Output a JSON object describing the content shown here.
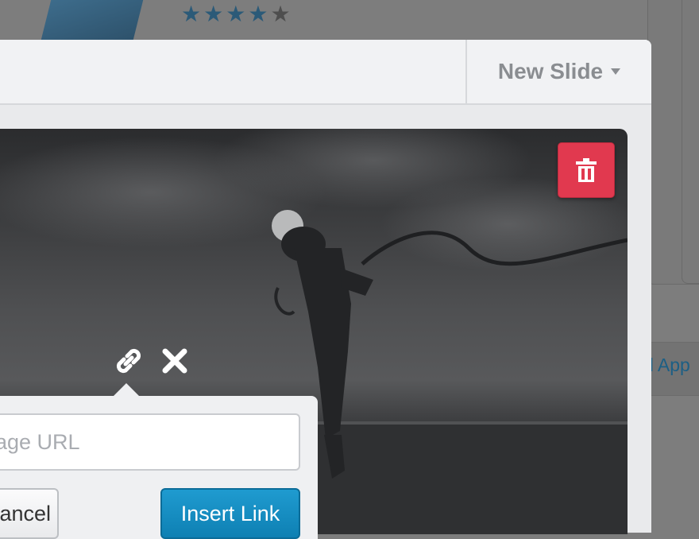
{
  "background": {
    "rating": {
      "stars_filled": 4,
      "stars_total": 5,
      "glyph": "★"
    },
    "link_text": "d App"
  },
  "modal": {
    "header": {
      "new_slide_label": "New Slide",
      "caret_icon": "caret-down-icon"
    }
  },
  "slide": {
    "delete_icon": "trash-icon",
    "delete_color": "#e1394f",
    "toolbar": {
      "link_icon": "link-icon",
      "close_icon": "close-icon"
    }
  },
  "link_popover": {
    "url_placeholder": "Image URL",
    "cancel_label": "Cancel",
    "insert_label": "Insert Link",
    "insert_color": "#1a8fc4"
  }
}
